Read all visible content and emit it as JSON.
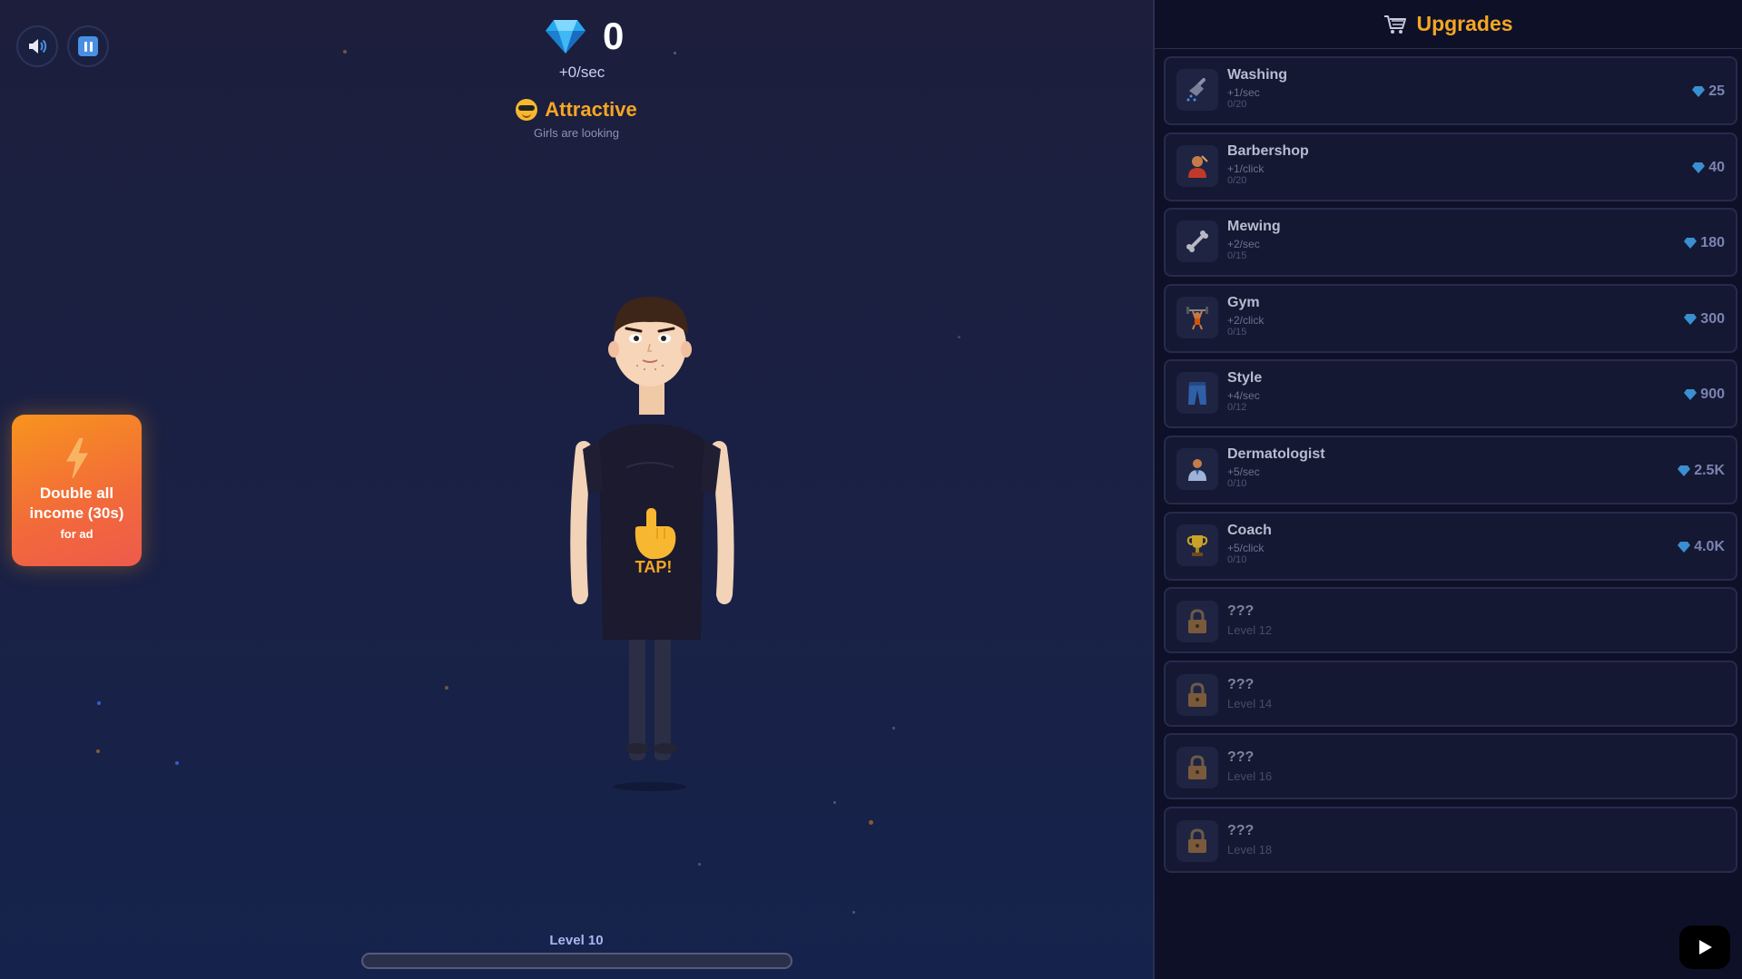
{
  "hud": {
    "gems": "0",
    "per_sec": "+0/sec",
    "rank_title": "Attractive",
    "rank_subtitle": "Girls are looking",
    "level_label": "Level 10",
    "level_progress": 0
  },
  "controls": {
    "sound_icon": "speaker-icon",
    "pause_icon": "pause-icon"
  },
  "ad_bonus": {
    "title": "Double all income (30s)",
    "subtitle": "for ad",
    "icon": "lightning-icon"
  },
  "character": {
    "tap_label": "TAP!"
  },
  "sidebar": {
    "title": "Upgrades",
    "icon": "shopping-cart-icon",
    "upgrades": [
      {
        "name": "Washing",
        "effect": "+1/sec",
        "count": "0/20",
        "cost": "25",
        "icon": "shower-icon"
      },
      {
        "name": "Barbershop",
        "effect": "+1/click",
        "count": "0/20",
        "cost": "40",
        "icon": "barber-icon"
      },
      {
        "name": "Mewing",
        "effect": "+2/sec",
        "count": "0/15",
        "cost": "180",
        "icon": "bone-icon"
      },
      {
        "name": "Gym",
        "effect": "+2/click",
        "count": "0/15",
        "cost": "300",
        "icon": "weightlifter-icon"
      },
      {
        "name": "Style",
        "effect": "+4/sec",
        "count": "0/12",
        "cost": "900",
        "icon": "jeans-icon"
      },
      {
        "name": "Dermatologist",
        "effect": "+5/sec",
        "count": "0/10",
        "cost": "2.5K",
        "icon": "doctor-icon"
      },
      {
        "name": "Coach",
        "effect": "+5/click",
        "count": "0/10",
        "cost": "4.0K",
        "icon": "trophy-icon"
      }
    ],
    "locked": [
      {
        "name": "???",
        "requirement": "Level 12",
        "icon": "lock-icon"
      },
      {
        "name": "???",
        "requirement": "Level 14",
        "icon": "lock-icon"
      },
      {
        "name": "???",
        "requirement": "Level 16",
        "icon": "lock-icon"
      },
      {
        "name": "???",
        "requirement": "Level 18",
        "icon": "lock-icon"
      }
    ]
  },
  "colors": {
    "accent": "#f5a623",
    "gem": "#4fc3f7",
    "panel": "#0d1027"
  }
}
